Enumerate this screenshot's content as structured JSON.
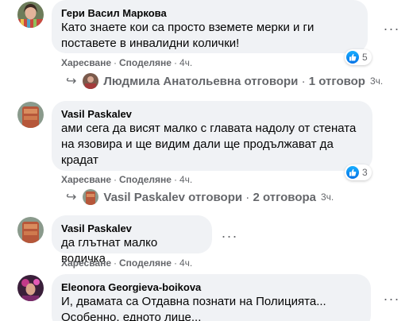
{
  "comments": [
    {
      "author": "Гери Васил Маркова",
      "lines": [
        "Като знаете кои са просто вземете мерки и ги",
        "поставете в инвалидни колички!"
      ],
      "like_label": "Харесване",
      "share_label": "Споделяне",
      "time": "4ч.",
      "reaction_count": "5",
      "replies": {
        "name": "Людмила Анатольевна",
        "action": "отговори",
        "count": "1 отговор",
        "time": "3ч."
      }
    },
    {
      "author": "Vasil Paskalev",
      "lines": [
        "ами сега да висят малко с главата надолу от стената",
        "на язовира и ще видим дали ще продължават да",
        "крадат"
      ],
      "like_label": "Харесване",
      "share_label": "Споделяне",
      "time": "4ч.",
      "reaction_count": "3",
      "replies": {
        "name": "Vasil Paskalev",
        "action": "отговори",
        "count": "2 отговора",
        "time": "3ч."
      }
    },
    {
      "author": "Vasil Paskalev",
      "lines": [
        "да глътнат малко водичка"
      ],
      "like_label": "Харесване",
      "share_label": "Споделяне",
      "time": "4ч."
    },
    {
      "author": "Eleonora Georgieva-boikova",
      "lines": [
        "И, двамата са Отдавна познати на Полицията...",
        "Особенно, едното лице..."
      ]
    }
  ],
  "colors": {
    "bubble": "#f0f2f5",
    "secondary_text": "#65676b",
    "like_blue": "#1877f2"
  },
  "icons": {
    "more": "more-options-icon",
    "like": "like-thumb-icon",
    "reply_arrow": "reply-arrow-icon"
  }
}
